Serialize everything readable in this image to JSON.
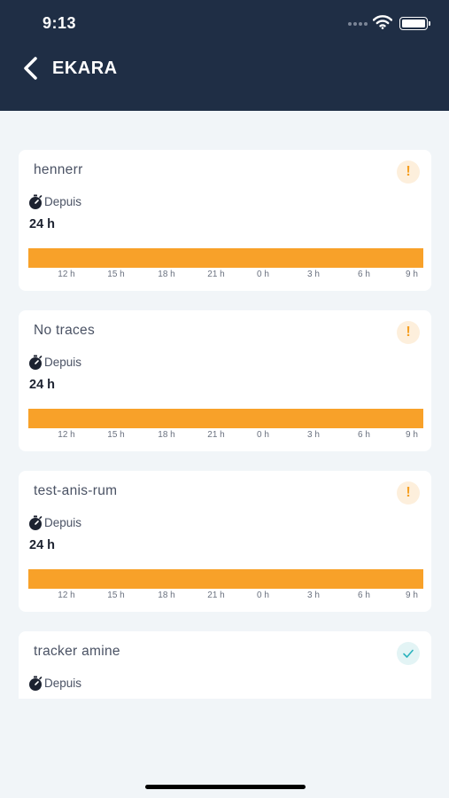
{
  "status_bar": {
    "time": "9:13"
  },
  "header": {
    "title": "EKARA"
  },
  "axis_ticks": [
    "12 h",
    "15 h",
    "18 h",
    "21 h",
    "0 h",
    "3 h",
    "6 h",
    "9 h"
  ],
  "cards": [
    {
      "name": "hennerr",
      "status": "warning",
      "status_icon": "warning-icon",
      "since_label": "Depuis",
      "duration": "24 h",
      "show_timeline": true
    },
    {
      "name": "No traces",
      "status": "warning",
      "status_icon": "warning-icon",
      "since_label": "Depuis",
      "duration": "24 h",
      "show_timeline": true
    },
    {
      "name": "test-anis-rum",
      "status": "warning",
      "status_icon": "warning-icon",
      "since_label": "Depuis",
      "duration": "24 h",
      "show_timeline": true
    },
    {
      "name": "tracker amine",
      "status": "ok",
      "status_icon": "checkmark-icon",
      "since_label": "Depuis",
      "duration": "",
      "show_timeline": false
    }
  ],
  "colors": {
    "header_bg": "#1f2e45",
    "page_bg": "#f1f5f8",
    "timeline_fill": "#f8a129",
    "warning_accent": "#f59f22",
    "ok_accent": "#2bb3bd"
  }
}
